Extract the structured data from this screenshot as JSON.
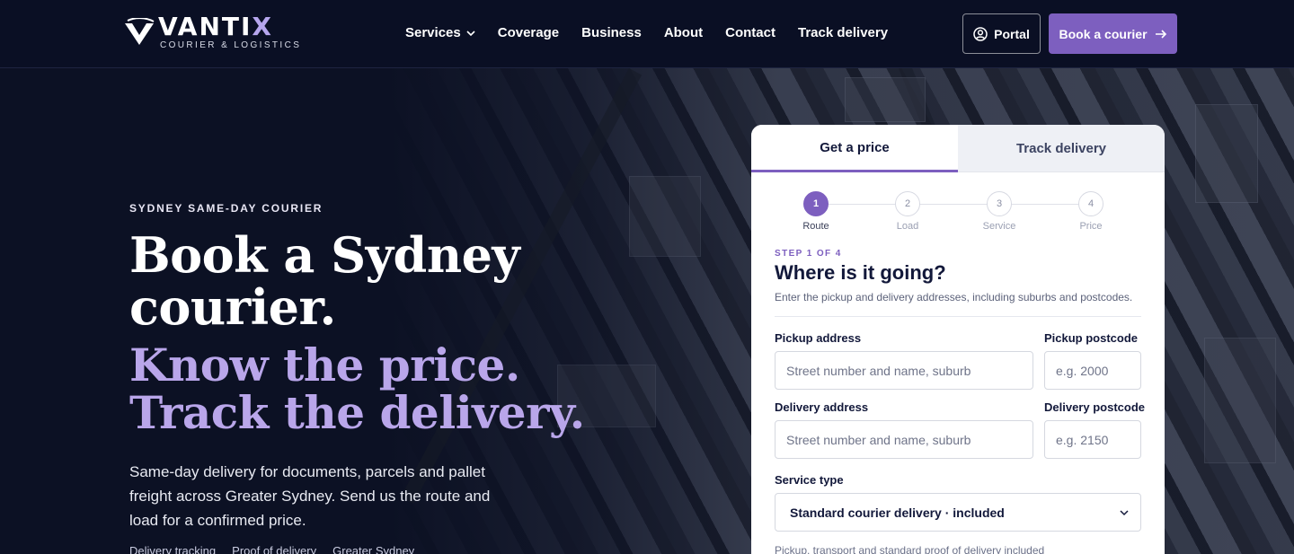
{
  "brand": {
    "name_main": "VANTI",
    "name_accent": "X",
    "tagline": "COURIER & LOGISTICS"
  },
  "nav": {
    "items": [
      "Services",
      "Coverage",
      "Business",
      "About",
      "Contact",
      "Track delivery"
    ],
    "portal_label": "Portal",
    "book_label": "Book a courier"
  },
  "hero": {
    "eyebrow": "SYDNEY SAME-DAY COURIER",
    "headline_line1": "Book a Sydney",
    "headline_line2": "courier.",
    "accent_line1": "Know the price.",
    "accent_line2": "Track the delivery.",
    "lead": "Same-day delivery for documents, parcels and pallet freight across Greater Sydney. Send us the route and load for a confirmed price.",
    "below_fold": "Delivery tracking     Proof of delivery     Greater Sydney"
  },
  "booking": {
    "tabs": [
      {
        "label": "Get a price",
        "active": true
      },
      {
        "label": "Track delivery",
        "active": false
      }
    ],
    "steps": [
      {
        "num": "1",
        "label": "Route",
        "active": true
      },
      {
        "num": "2",
        "label": "Load",
        "active": false
      },
      {
        "num": "3",
        "label": "Service",
        "active": false
      },
      {
        "num": "4",
        "label": "Price",
        "active": false
      }
    ],
    "kicker": "STEP 1 OF 4",
    "title": "Where is it going?",
    "description": "Enter the pickup and delivery addresses, including suburbs and postcodes.",
    "pickup_address_label": "Pickup address",
    "pickup_address_placeholder": "Street number and name, suburb",
    "pickup_postcode_label": "Pickup postcode",
    "pickup_postcode_placeholder": "e.g. 2000",
    "delivery_address_label": "Delivery address",
    "delivery_address_placeholder": "Street number and name, suburb",
    "delivery_postcode_label": "Delivery postcode",
    "delivery_postcode_placeholder": "e.g. 2150",
    "service_type_label": "Service type",
    "service_type_value": "Standard courier delivery · included",
    "service_note": "Pickup, transport and standard proof of delivery included"
  },
  "colors": {
    "accent": "#7d5fbf",
    "accent_light": "#b9a6ea",
    "navy": "#0a0f24",
    "ink": "#12183a"
  },
  "icons": {
    "portal": "user-circle-icon",
    "book": "arrow-right-icon",
    "services": "chevron-down-icon",
    "select": "chevron-down-icon"
  }
}
